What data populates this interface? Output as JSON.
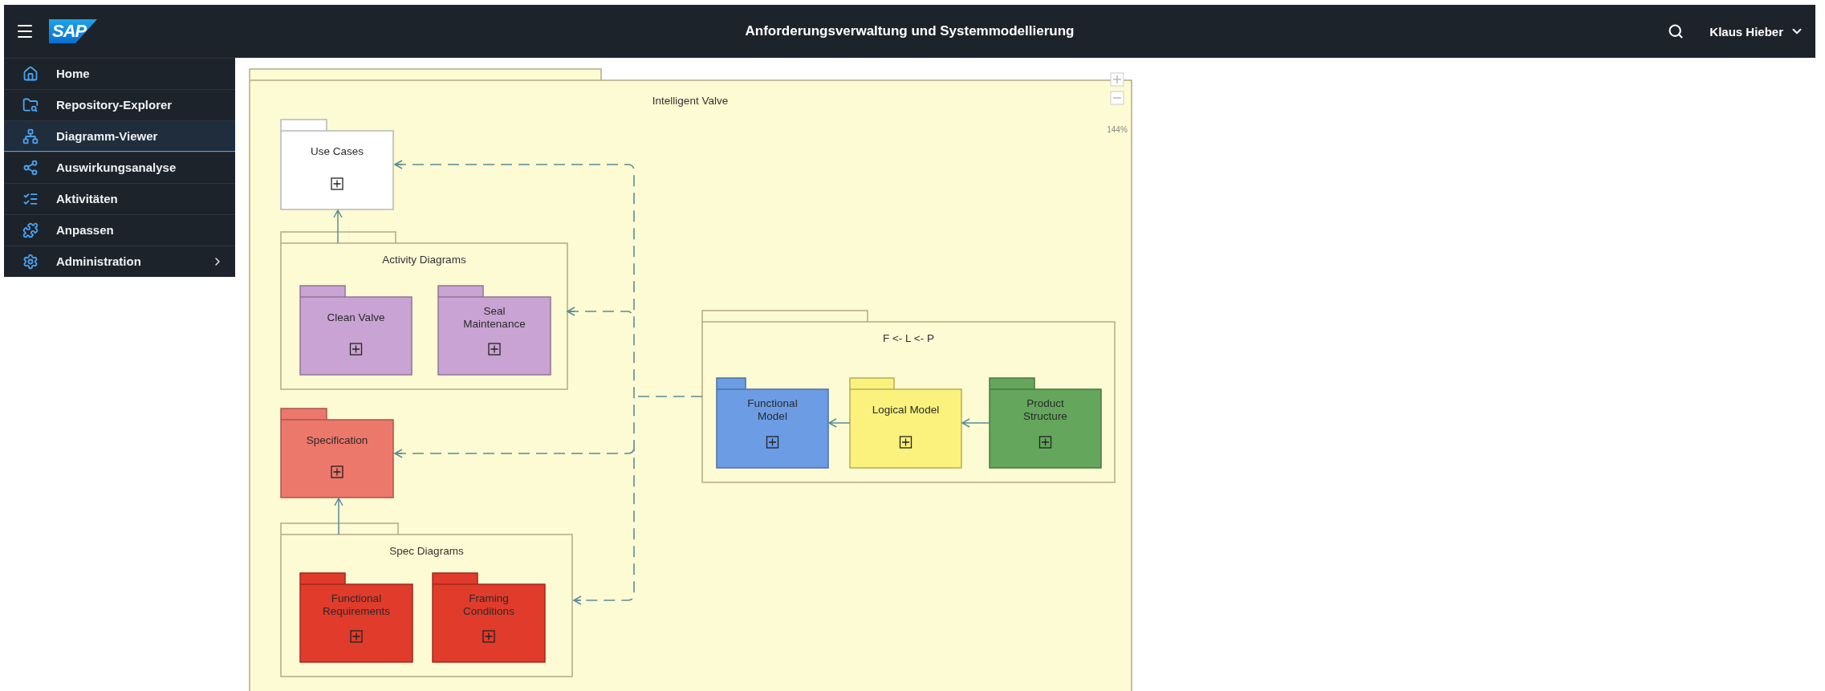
{
  "header": {
    "logo": "SAP",
    "title": "Anforderungsverwaltung und Systemmodellierung",
    "user": "Klaus Hieber"
  },
  "sidebar": {
    "items": [
      {
        "label": "Home",
        "selected": false
      },
      {
        "label": "Repository-Explorer",
        "selected": false
      },
      {
        "label": "Diagramm-Viewer",
        "selected": true
      },
      {
        "label": "Auswirkungsanalyse",
        "selected": false
      },
      {
        "label": "Aktivitäten",
        "selected": false
      },
      {
        "label": "Anpassen",
        "selected": false
      },
      {
        "label": "Administration",
        "selected": false,
        "expandable": true
      }
    ]
  },
  "diagram": {
    "title": "Intelligent Valve",
    "zoom": "144%",
    "packages": [
      {
        "kind": "leaf",
        "label": "Use Cases",
        "color": "#ffffff"
      },
      {
        "kind": "group",
        "label": "Activity Diagrams",
        "children": [
          {
            "kind": "leaf",
            "label": "Clean Valve",
            "color": "#c9a3d3"
          },
          {
            "kind": "leaf",
            "label": "Seal Maintenance",
            "color": "#c9a3d3"
          }
        ]
      },
      {
        "kind": "group",
        "label": "F <- L <- P",
        "children": [
          {
            "kind": "leaf",
            "label": "Functional Model",
            "color": "#6b9ce4"
          },
          {
            "kind": "leaf",
            "label": "Logical Model",
            "color": "#faf27c"
          },
          {
            "kind": "leaf",
            "label": "Product Structure",
            "color": "#64a65c"
          }
        ]
      },
      {
        "kind": "leaf",
        "label": "Specification",
        "color": "#ec786c"
      },
      {
        "kind": "group",
        "label": "Spec Diagrams",
        "children": [
          {
            "kind": "leaf",
            "label": "Functional Requirements",
            "color": "#e03b2b"
          },
          {
            "kind": "leaf",
            "label": "Framing Conditions",
            "color": "#e03b2b"
          }
        ]
      }
    ]
  }
}
